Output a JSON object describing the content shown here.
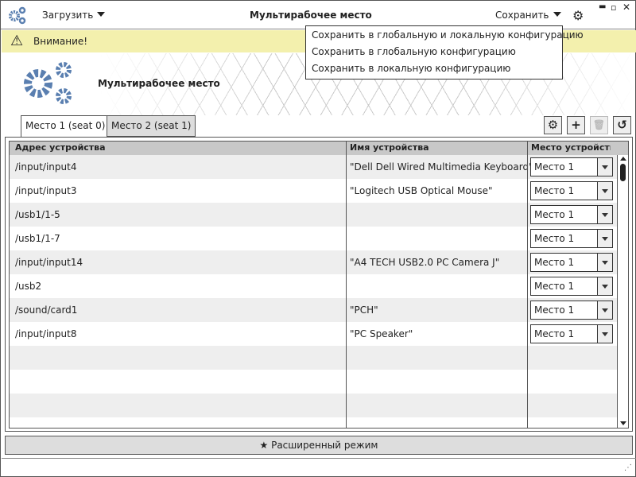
{
  "titlebar": {
    "title": "Мультирабочее место",
    "load_label": "Загрузить",
    "save_label": "Сохранить"
  },
  "save_menu": [
    "Сохранить в глобальную и локальную конфигурацию",
    "Сохранить в глобальную конфигурацию",
    "Сохранить в локальную конфигурацию"
  ],
  "warning": {
    "text": "Внимание!"
  },
  "header": {
    "title": "Мультирабочее место"
  },
  "tabs": [
    {
      "label": "Место 1 (seat 0)",
      "active": true
    },
    {
      "label": "Место 2 (seat 1)",
      "active": false
    }
  ],
  "table": {
    "columns": [
      "Адрес устройства",
      "Имя устройства",
      "Место устройства"
    ],
    "rows": [
      {
        "address": "/input/input4",
        "name": "\"Dell Dell Wired Multimedia Keyboard\"",
        "seat": "Место 1"
      },
      {
        "address": "/input/input3",
        "name": "\"Logitech USB Optical Mouse\"",
        "seat": "Место 1"
      },
      {
        "address": "/usb1/1-5",
        "name": "",
        "seat": "Место 1"
      },
      {
        "address": "/usb1/1-7",
        "name": "",
        "seat": "Место 1"
      },
      {
        "address": "/input/input14",
        "name": "\"A4 TECH USB2.0 PC Camera J\"",
        "seat": "Место 1"
      },
      {
        "address": "/usb2",
        "name": "",
        "seat": "Место 1"
      },
      {
        "address": "/sound/card1",
        "name": "\"PCH\"",
        "seat": "Место 1"
      },
      {
        "address": "/input/input8",
        "name": "\"PC Speaker\"",
        "seat": "Место 1"
      }
    ]
  },
  "advanced_label": "Расширенный режим",
  "colors": {
    "accent": "#5a7fb0",
    "warning_bg": "#f3f0ad"
  }
}
